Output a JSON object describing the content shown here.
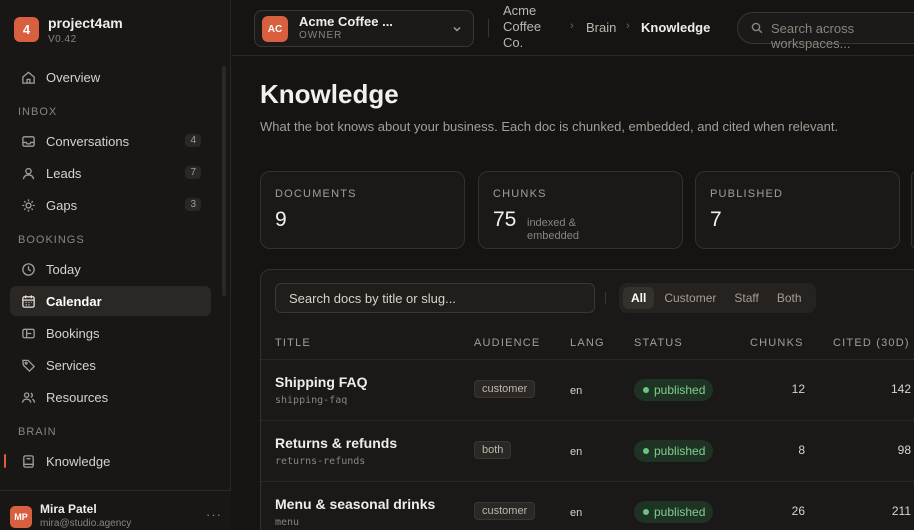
{
  "brand": {
    "logo": "4",
    "name": "project4am",
    "version": "V0.42"
  },
  "nav": {
    "overview": "Overview",
    "inbox_section": "INBOX",
    "conversations": {
      "label": "Conversations",
      "count": "4"
    },
    "leads": {
      "label": "Leads",
      "count": "7"
    },
    "gaps": {
      "label": "Gaps",
      "count": "3"
    },
    "bookings_section": "BOOKINGS",
    "today": "Today",
    "calendar": "Calendar",
    "bookings": "Bookings",
    "services": "Services",
    "resources": "Resources",
    "brain_section": "BRAIN",
    "knowledge": "Knowledge"
  },
  "user": {
    "initials": "MP",
    "name": "Mira Patel",
    "email": "mira@studio.agency",
    "more": "···"
  },
  "workspace": {
    "initials": "AC",
    "name": "Acme Coffee ...",
    "role": "OWNER"
  },
  "breadcrumb": {
    "workspace": "Acme Coffee Co.",
    "section": "Brain",
    "current": "Knowledge",
    "separator": "›"
  },
  "search": {
    "placeholder": "Search across workspaces..."
  },
  "page": {
    "title": "Knowledge",
    "subtitle": "What the bot knows about your business. Each doc is chunked, embedded, and cited when relevant."
  },
  "stats": {
    "documents": {
      "label": "DOCUMENTS",
      "value": "9"
    },
    "chunks": {
      "label": "CHUNKS",
      "value": "75",
      "note": "indexed & embedded"
    },
    "published": {
      "label": "PUBLISHED",
      "value": "7"
    }
  },
  "docs": {
    "search_placeholder": "Search docs by title or slug...",
    "filters": [
      "All",
      "Customer",
      "Staff",
      "Both"
    ],
    "active_filter": "All",
    "columns": {
      "title": "TITLE",
      "audience": "AUDIENCE",
      "lang": "LANG",
      "status": "STATUS",
      "chunks": "CHUNKS",
      "cited": "CITED (30D)"
    },
    "rows": [
      {
        "title": "Shipping FAQ",
        "slug": "shipping-faq",
        "audience": "customer",
        "lang": "en",
        "status": "published",
        "chunks": "12",
        "cited": "142"
      },
      {
        "title": "Returns & refunds",
        "slug": "returns-refunds",
        "audience": "both",
        "lang": "en",
        "status": "published",
        "chunks": "8",
        "cited": "98"
      },
      {
        "title": "Menu & seasonal drinks",
        "slug": "menu",
        "audience": "customer",
        "lang": "en",
        "status": "published",
        "chunks": "26",
        "cited": "211"
      }
    ]
  },
  "colors": {
    "accent": "#d9603f",
    "status_green": "#7fcf8e",
    "background": "#161412"
  }
}
